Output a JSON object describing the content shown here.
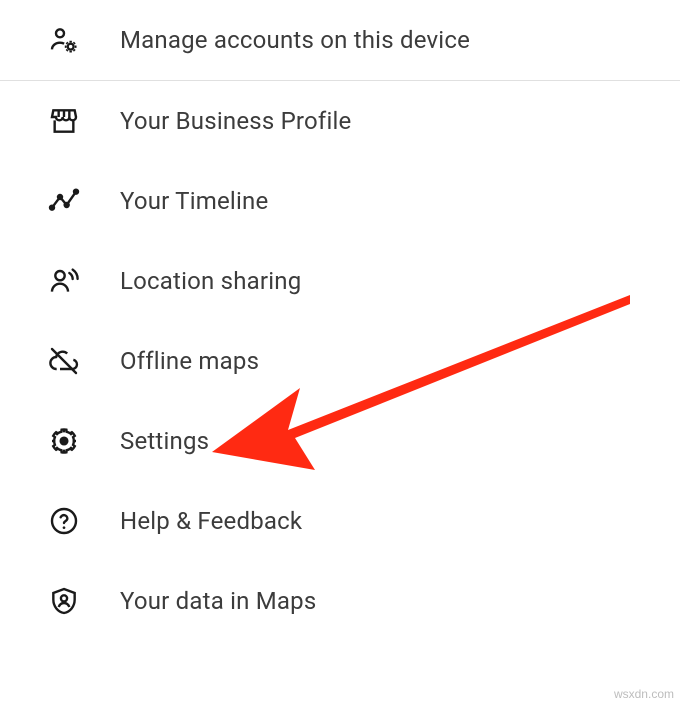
{
  "menu": {
    "items": [
      {
        "id": "manage-accounts",
        "label": "Manage accounts on this device",
        "icon": "person-gear-icon"
      },
      {
        "id": "business-profile",
        "label": "Your Business Profile",
        "icon": "storefront-icon"
      },
      {
        "id": "timeline",
        "label": "Your Timeline",
        "icon": "timeline-icon"
      },
      {
        "id": "location-sharing",
        "label": "Location sharing",
        "icon": "location-sharing-icon"
      },
      {
        "id": "offline-maps",
        "label": "Offline maps",
        "icon": "cloud-off-icon"
      },
      {
        "id": "settings",
        "label": "Settings",
        "icon": "gear-icon"
      },
      {
        "id": "help-feedback",
        "label": "Help & Feedback",
        "icon": "help-circle-icon"
      },
      {
        "id": "your-data",
        "label": "Your data in Maps",
        "icon": "shield-person-icon"
      }
    ]
  },
  "annotation": {
    "arrow_color": "#ff2a12"
  },
  "watermark": "wsxdn.com"
}
